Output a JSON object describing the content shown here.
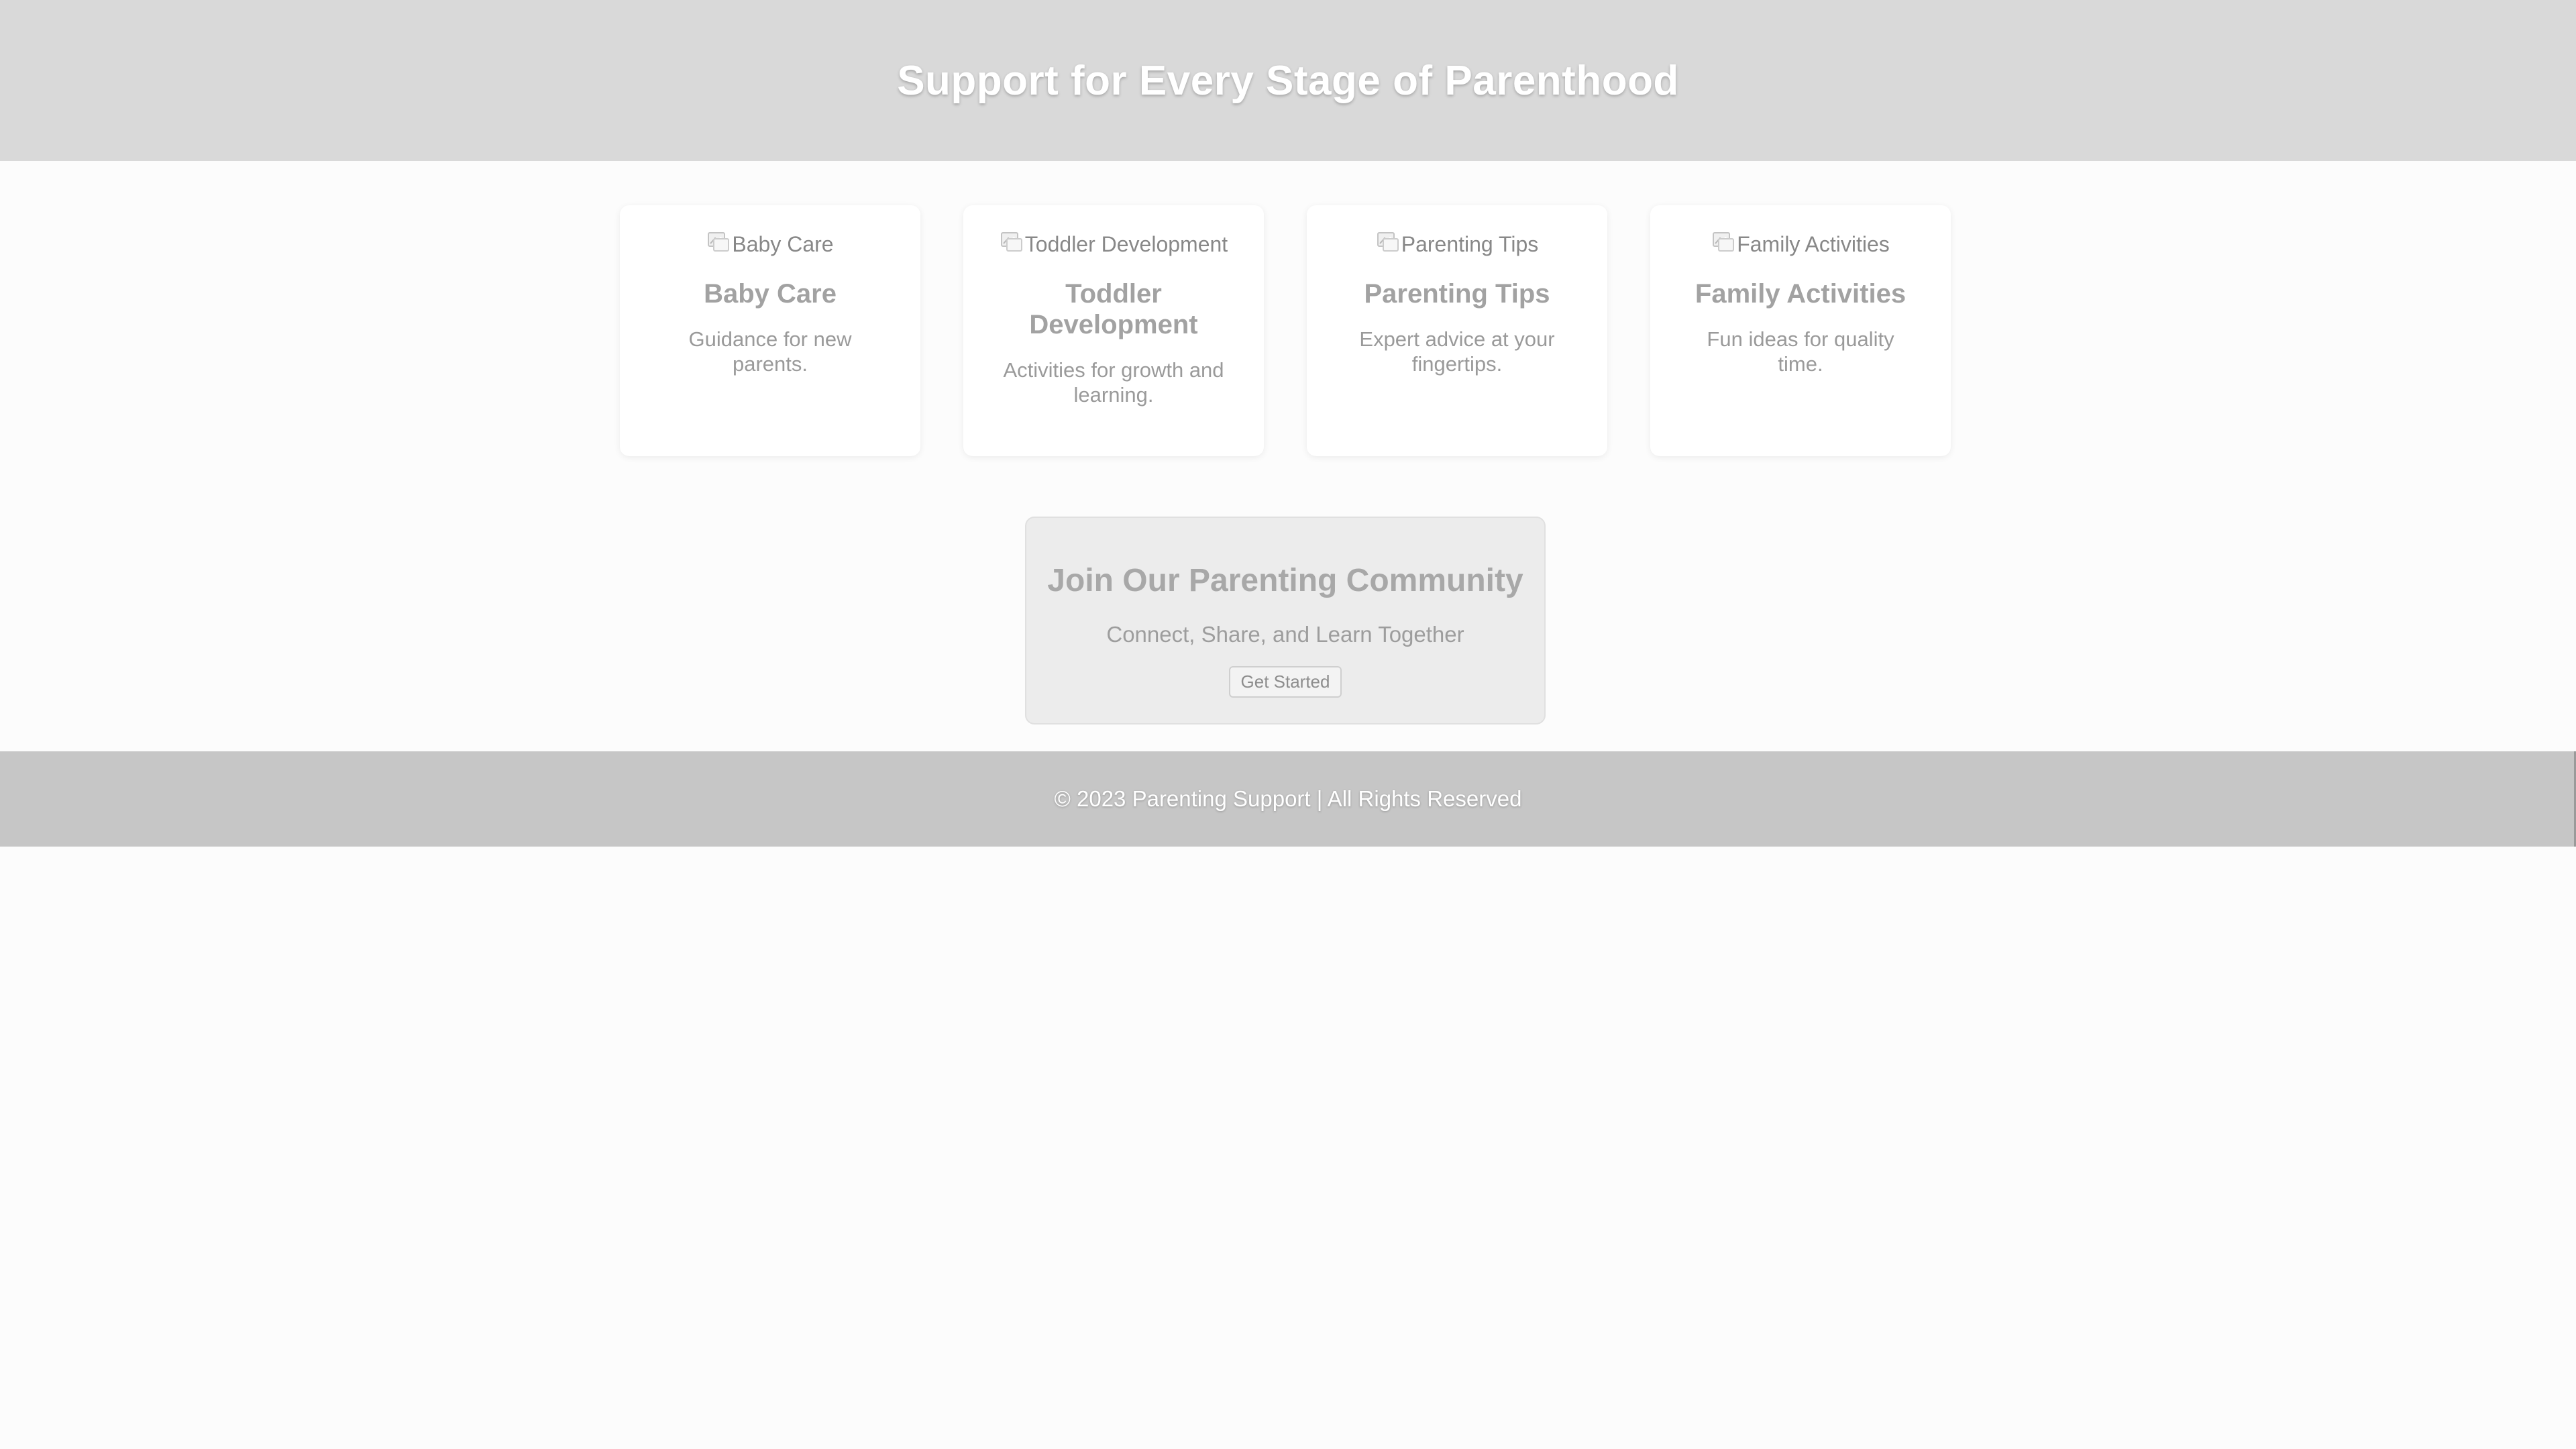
{
  "header": {
    "title": "Support for Every Stage of Parenthood"
  },
  "cards": [
    {
      "image_alt": "Baby Care",
      "icon": "broken-image-icon",
      "title": "Baby Care",
      "description": "Guidance for new parents."
    },
    {
      "image_alt": "Toddler Development",
      "icon": "broken-image-icon",
      "title": "Toddler Development",
      "description": "Activities for growth and learning."
    },
    {
      "image_alt": "Parenting Tips",
      "icon": "broken-image-icon",
      "title": "Parenting Tips",
      "description": "Expert advice at your fingertips."
    },
    {
      "image_alt": "Family Activities",
      "icon": "broken-image-icon",
      "title": "Family Activities",
      "description": "Fun ideas for quality time."
    }
  ],
  "community": {
    "title": "Join Our Parenting Community",
    "subtitle": "Connect, Share, and Learn Together",
    "button_label": "Get Started"
  },
  "footer": {
    "text": "© 2023 Parenting Support | All Rights Reserved"
  },
  "colors": {
    "header_bg": "#d9d9d9",
    "footer_bg": "#c6c6c6",
    "community_bg": "#ececec",
    "page_bg": "#fcfcfc"
  }
}
